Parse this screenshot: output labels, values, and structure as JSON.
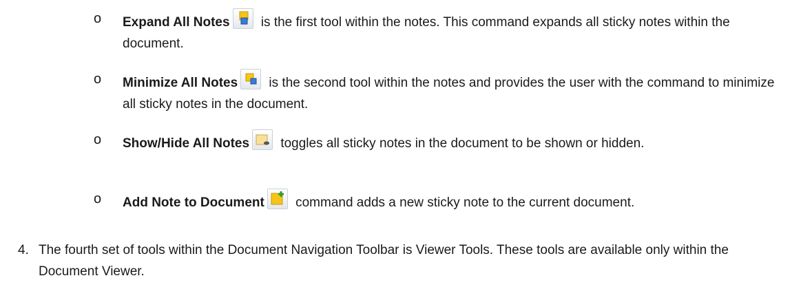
{
  "items": [
    {
      "bullet": "o",
      "title": "Expand All Notes",
      "icon": "expand-notes-icon",
      "text": " is the first tool within the notes.  This command expands all sticky notes within the document."
    },
    {
      "bullet": "o",
      "title": "Minimize All Notes",
      "icon": "minimize-notes-icon",
      "text": " is the second tool within the notes and provides the user with the command to minimize all sticky notes in the document."
    },
    {
      "bullet": "o",
      "title": "Show/Hide All Notes",
      "icon": "show-hide-notes-icon",
      "text": " toggles all sticky notes in the document to be shown or hidden."
    },
    {
      "bullet": "o",
      "title": "Add Note to Document",
      "icon": "add-note-icon",
      "text": " command adds a new sticky note to the current document."
    }
  ],
  "numbered": {
    "number": "4.",
    "text": "The fourth set of tools within the Document Navigation Toolbar is Viewer Tools.  These tools are available only within the Document Viewer."
  }
}
